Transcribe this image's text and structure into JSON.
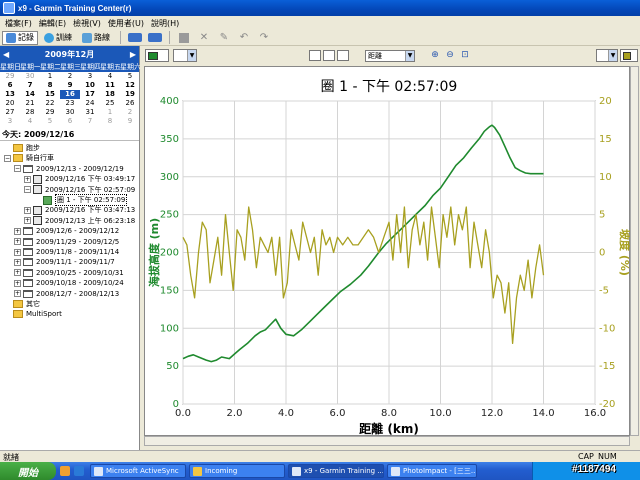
{
  "window": {
    "title": "x9 - Garmin Training Center(r)"
  },
  "menu": [
    "檔案(F)",
    "編輯(E)",
    "檢視(V)",
    "使用者(U)",
    "說明(H)"
  ],
  "toolbar": {
    "tabs": [
      "記錄",
      "訓練",
      "路線"
    ],
    "selected_tab": "記錄"
  },
  "calendar": {
    "month_label": "2009年12月",
    "weekdays": [
      "星期日",
      "星期一",
      "星期二",
      "星期三",
      "星期四",
      "星期五",
      "星期六"
    ],
    "weeks": [
      [
        "29",
        "30",
        "1",
        "2",
        "3",
        "4",
        "5"
      ],
      [
        "6",
        "7",
        "8",
        "9",
        "10",
        "11",
        "12"
      ],
      [
        "13",
        "14",
        "15",
        "16",
        "17",
        "18",
        "19"
      ],
      [
        "20",
        "21",
        "22",
        "23",
        "24",
        "25",
        "26"
      ],
      [
        "27",
        "28",
        "29",
        "30",
        "31",
        "1",
        "2"
      ],
      [
        "3",
        "4",
        "5",
        "6",
        "7",
        "8",
        "9"
      ]
    ],
    "selected_day": "16",
    "today_label": "今天: 2009/12/16"
  },
  "tree": [
    {
      "label": "跑步",
      "type": "folder",
      "level": 0
    },
    {
      "label": "騎自行車",
      "type": "folder",
      "level": 0,
      "expand": "−"
    },
    {
      "label": "2009/12/13 - 2009/12/19",
      "type": "week",
      "level": 1,
      "expand": "−"
    },
    {
      "label": "2009/12/16 下午 03:49:17",
      "type": "activity",
      "level": 2,
      "expand": "+"
    },
    {
      "label": "2009/12/16 下午 02:57:09",
      "type": "activity",
      "level": 2,
      "expand": "−"
    },
    {
      "label": "圈 1 - 下午 02:57:09",
      "type": "lap",
      "level": 3,
      "selected": true
    },
    {
      "label": "2009/12/16 下午 03:47:13",
      "type": "activity",
      "level": 2,
      "expand": "+"
    },
    {
      "label": "2009/12/13 上午 06:23:18",
      "type": "activity",
      "level": 2,
      "expand": "+"
    },
    {
      "label": "2009/12/6 - 2009/12/12",
      "type": "week",
      "level": 1,
      "expand": "+"
    },
    {
      "label": "2009/11/29 - 2009/12/5",
      "type": "week",
      "level": 1,
      "expand": "+"
    },
    {
      "label": "2009/11/8 - 2009/11/14",
      "type": "week",
      "level": 1,
      "expand": "+"
    },
    {
      "label": "2009/11/1 - 2009/11/7",
      "type": "week",
      "level": 1,
      "expand": "+"
    },
    {
      "label": "2009/10/25 - 2009/10/31",
      "type": "week",
      "level": 1,
      "expand": "+"
    },
    {
      "label": "2009/10/18 - 2009/10/24",
      "type": "week",
      "level": 1,
      "expand": "+"
    },
    {
      "label": "2008/12/7 - 2008/12/13",
      "type": "week",
      "level": 1,
      "expand": "+"
    },
    {
      "label": "其它",
      "type": "folder",
      "level": 0
    },
    {
      "label": "MultiSport",
      "type": "folder",
      "level": 0
    }
  ],
  "chart_toolbar": {
    "x_axis_select": "距離",
    "left_color": "#1f8a2e",
    "right_color": "#a8a020"
  },
  "chart_data": {
    "type": "line",
    "title": "圈 1 - 下午 02:57:09",
    "xlabel": "距離 (km)",
    "ylabel": "海拔高度 (m)",
    "y2label": "坡度 (%)",
    "xlim": [
      0,
      16
    ],
    "ylim": [
      0,
      400
    ],
    "y2lim": [
      -20,
      20
    ],
    "xticks": [
      "0.0",
      "2.0",
      "4.0",
      "6.0",
      "8.0",
      "10.0",
      "12.0",
      "14.0",
      "16.0"
    ],
    "yticks": [
      "0",
      "50",
      "100",
      "150",
      "200",
      "250",
      "300",
      "350",
      "400"
    ],
    "y2ticks": [
      "-20",
      "-15",
      "-10",
      "-5",
      "0",
      "5",
      "10",
      "15",
      "20"
    ],
    "grid": true,
    "series": [
      {
        "name": "海拔高度",
        "axis": "left",
        "color": "#1f8a2e",
        "x": [
          0.0,
          0.2,
          0.4,
          0.6,
          0.9,
          1.1,
          1.3,
          1.5,
          1.8,
          2.0,
          2.2,
          2.5,
          2.8,
          3.0,
          3.2,
          3.4,
          3.6,
          3.8,
          4.0,
          4.3,
          4.6,
          4.9,
          5.2,
          5.5,
          5.8,
          6.1,
          6.5,
          6.9,
          7.2,
          7.6,
          7.9,
          8.2,
          8.5,
          8.8,
          9.1,
          9.4,
          9.7,
          10.0,
          10.3,
          10.6,
          10.9,
          11.2,
          11.5,
          11.7,
          11.9,
          12.0,
          12.1,
          12.3,
          12.5,
          12.7,
          12.9,
          13.1,
          13.3,
          13.5,
          13.7,
          13.9,
          14.0
        ],
        "y": [
          60,
          63,
          65,
          62,
          58,
          56,
          58,
          62,
          60,
          66,
          72,
          80,
          90,
          95,
          98,
          105,
          112,
          100,
          92,
          90,
          98,
          108,
          118,
          128,
          138,
          148,
          158,
          170,
          182,
          200,
          212,
          222,
          232,
          242,
          252,
          262,
          275,
          285,
          300,
          315,
          325,
          338,
          350,
          360,
          366,
          368,
          365,
          355,
          340,
          325,
          312,
          308,
          305,
          304,
          304,
          304,
          304
        ]
      },
      {
        "name": "坡度",
        "axis": "right",
        "color": "#a8a020",
        "x": [
          0.0,
          0.15,
          0.3,
          0.45,
          0.6,
          0.75,
          0.9,
          1.05,
          1.2,
          1.35,
          1.5,
          1.65,
          1.8,
          1.95,
          2.1,
          2.25,
          2.4,
          2.55,
          2.7,
          2.85,
          3.0,
          3.15,
          3.3,
          3.45,
          3.6,
          3.75,
          3.9,
          4.05,
          4.2,
          4.35,
          4.5,
          4.65,
          4.8,
          4.95,
          5.1,
          5.25,
          5.4,
          5.55,
          5.7,
          5.85,
          6.0,
          6.2,
          6.4,
          6.6,
          6.8,
          7.0,
          7.2,
          7.4,
          7.6,
          7.8,
          8.0,
          8.15,
          8.3,
          8.45,
          8.6,
          8.75,
          8.9,
          9.05,
          9.2,
          9.35,
          9.5,
          9.65,
          9.8,
          9.95,
          10.1,
          10.25,
          10.4,
          10.55,
          10.7,
          10.85,
          11.0,
          11.15,
          11.3,
          11.45,
          11.6,
          11.75,
          11.9,
          12.05,
          12.2,
          12.35,
          12.5,
          12.65,
          12.8,
          12.95,
          13.1,
          13.25,
          13.4,
          13.55,
          13.7,
          13.85,
          14.0
        ],
        "y": [
          2,
          1,
          -3,
          -6,
          0,
          4,
          3,
          -4,
          -1,
          2,
          -3,
          5,
          0,
          -5,
          3,
          2,
          -1,
          6,
          3,
          -2,
          2,
          1,
          0,
          2,
          -3,
          2,
          -6,
          -4,
          3,
          1,
          -1,
          4,
          2,
          0,
          2,
          -3,
          3,
          1,
          2,
          0,
          2,
          1,
          2,
          1,
          1,
          2,
          3,
          2,
          0,
          2,
          4,
          -1,
          5,
          0,
          6,
          -2,
          3,
          5,
          1,
          4,
          -1,
          6,
          2,
          -2,
          5,
          2,
          6,
          1,
          5,
          3,
          6,
          -2,
          4,
          1,
          -2,
          3,
          0,
          -6,
          -3,
          -4,
          -8,
          -4,
          -12,
          -6,
          -3,
          -5,
          -1,
          -6,
          -2,
          1,
          -3
        ]
      }
    ]
  },
  "status": {
    "left": "就緒",
    "cap": "CAP",
    "num": "NUM"
  },
  "taskbar": {
    "start_label": "開始",
    "items": [
      "Microsoft ActiveSync",
      "Incoming",
      "x9 - Garmin Training ...",
      "PhotoImpact - [三三..."
    ]
  },
  "watermark": "#1187494"
}
